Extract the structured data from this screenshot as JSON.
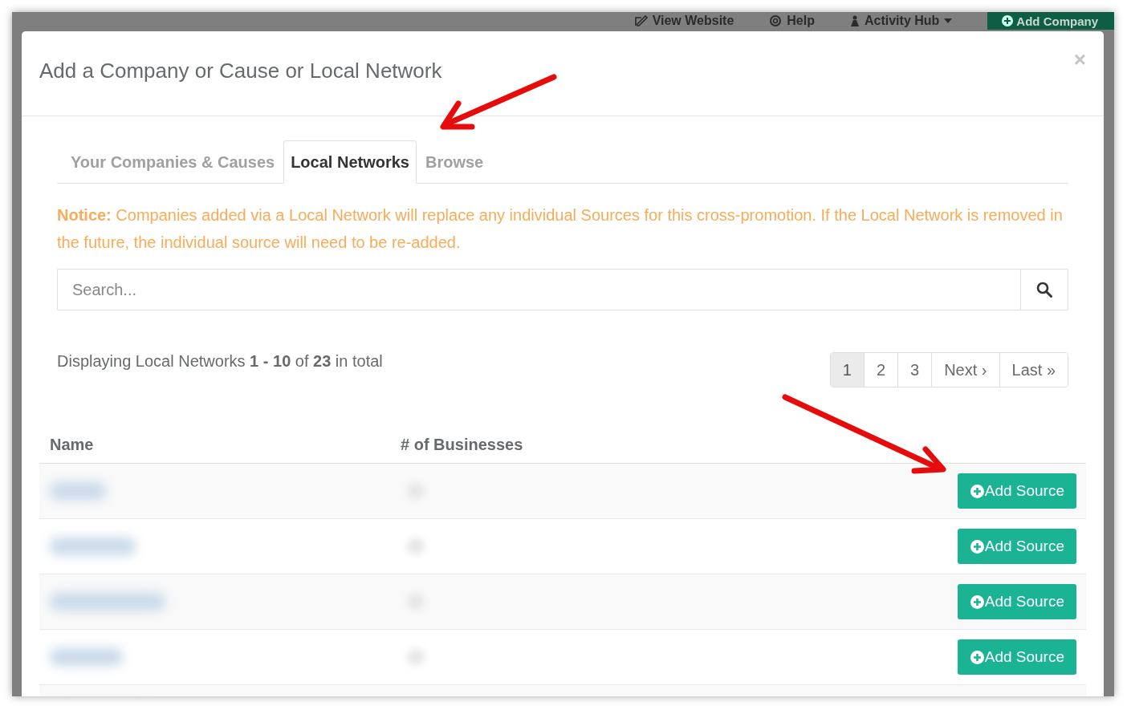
{
  "background_nav": {
    "items": [
      {
        "kind": "link",
        "label": "View Website"
      },
      {
        "kind": "link",
        "label": "Help"
      },
      {
        "kind": "dropdown",
        "label": "Activity Hub"
      },
      {
        "kind": "button",
        "label": "Add Company"
      }
    ]
  },
  "modal": {
    "title": "Add a Company or Cause or Local Network",
    "close": "×",
    "tabs": [
      {
        "label": "Your Companies & Causes",
        "selected": false
      },
      {
        "label": "Local Networks",
        "selected": true
      },
      {
        "label": "Browse",
        "selected": false
      }
    ],
    "notice": "**Notice:** Companies added via a Local Network will replace any individual Sources for this cross-promotion. If the Local Network is removed in the future, the individual source will need to be re-added.",
    "search": {
      "placeholder": "Search..."
    },
    "summary": "Displaying Local Networks **1 - 10** of **23** in total",
    "pagination": [
      {
        "label": "1",
        "selected": true
      },
      {
        "label": "2",
        "selected": false
      },
      {
        "label": "3",
        "selected": false
      },
      {
        "label": "Next ›",
        "selected": false
      },
      {
        "label": "Last »",
        "selected": false
      }
    ],
    "table": {
      "columns": [
        "Name",
        "# of Businesses"
      ],
      "rows": [
        {
          "kind": "full",
          "action": "Add Source"
        },
        {
          "kind": "full",
          "action": "Add Source"
        },
        {
          "kind": "full",
          "action": "Add Source"
        },
        {
          "kind": "full",
          "action": "Add Source"
        },
        {
          "kind": "cut"
        }
      ]
    }
  }
}
